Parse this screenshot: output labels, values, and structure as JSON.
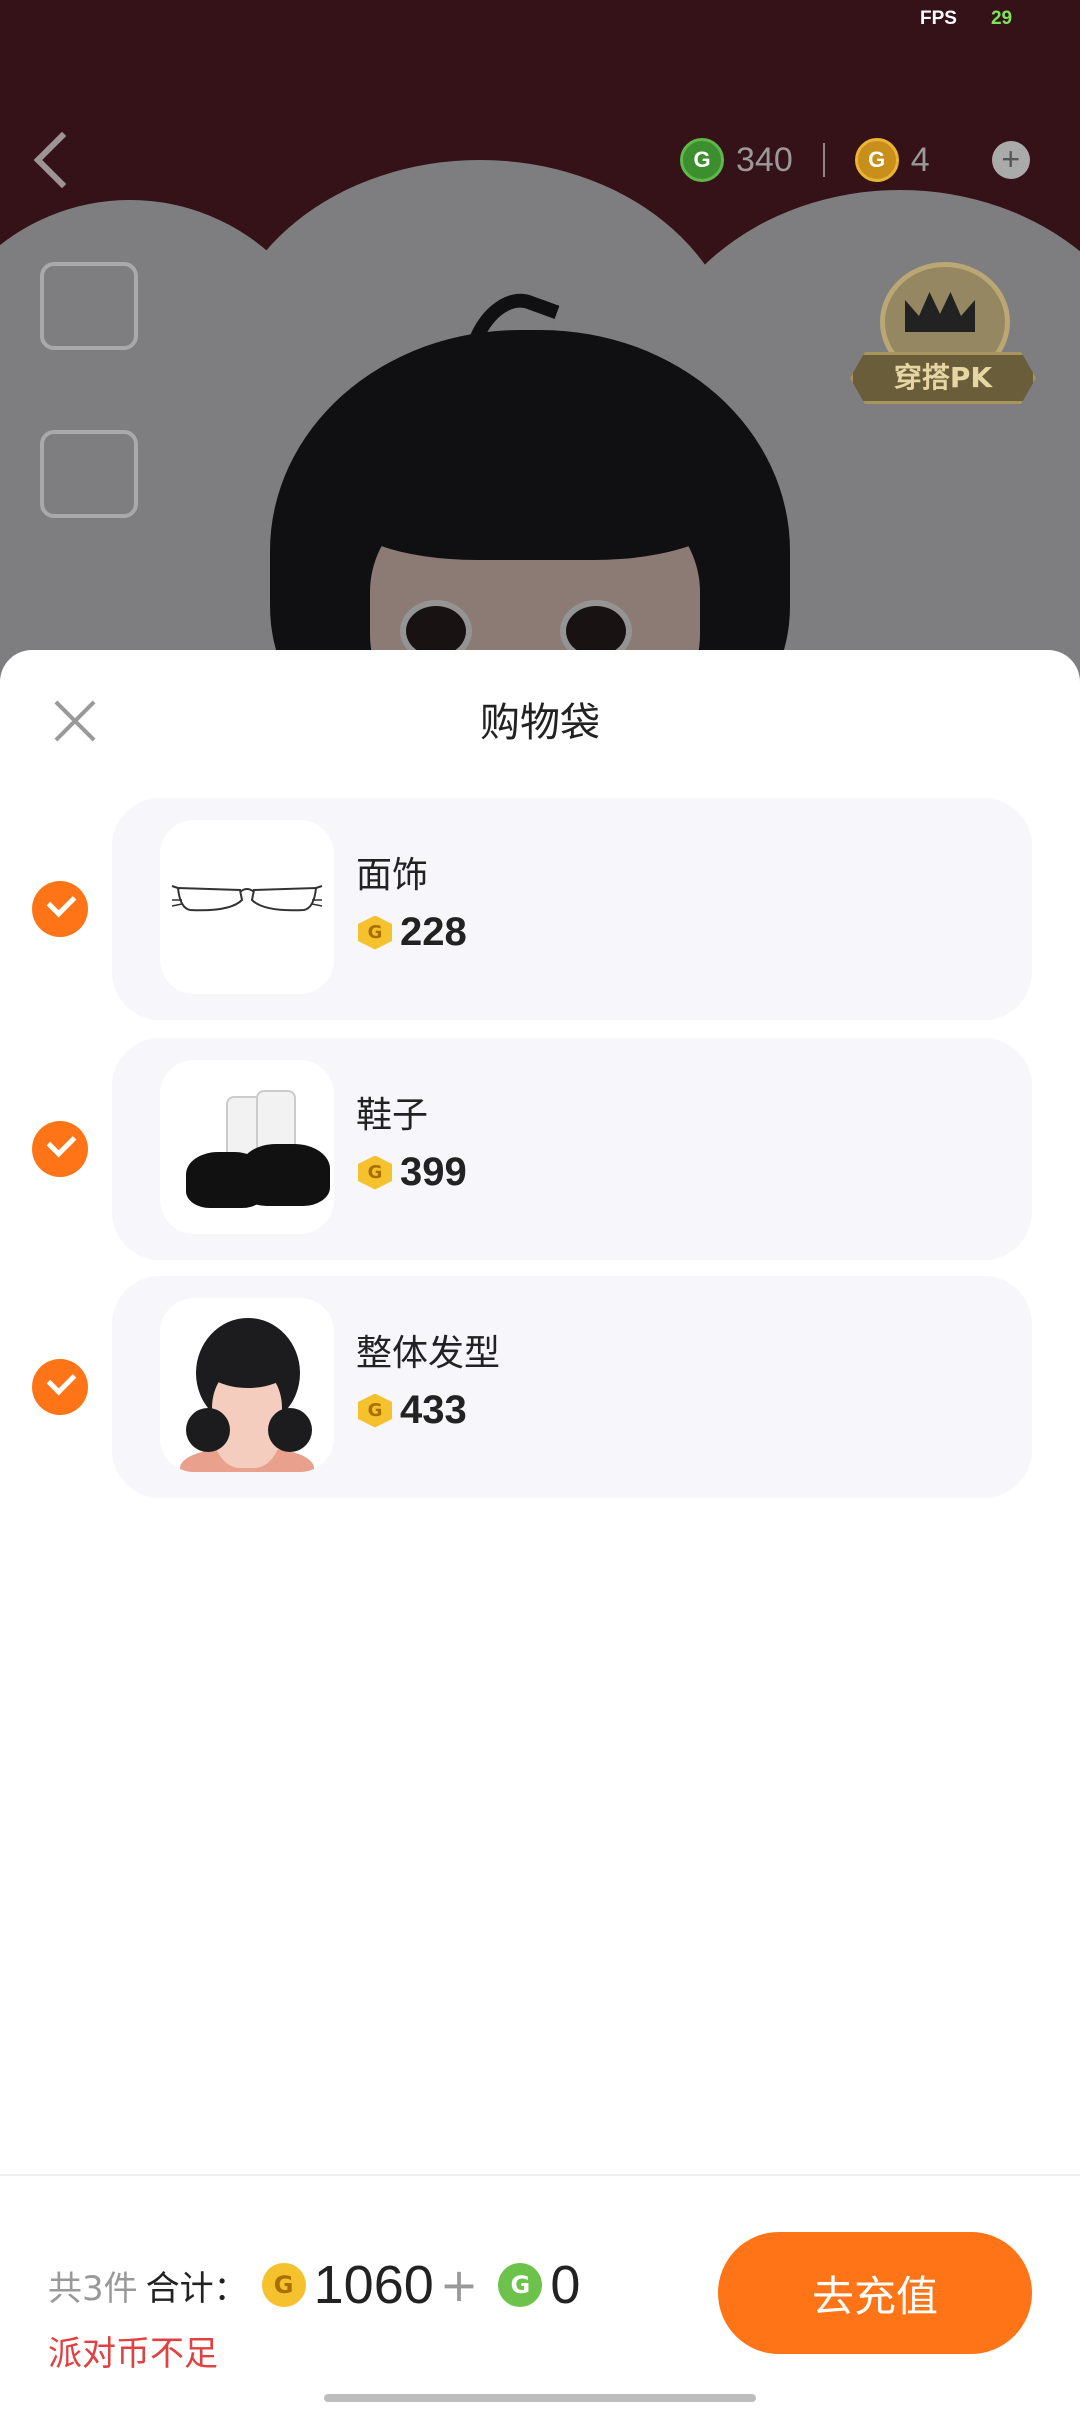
{
  "overlay": {
    "fps_label": "FPS",
    "fps_value": "29",
    "currencies": [
      {
        "icon": "green-coin-icon",
        "value": "340"
      },
      {
        "icon": "gold-coin-icon",
        "value": "4"
      }
    ],
    "pk_label": "穿搭PK"
  },
  "sheet": {
    "title": "购物袋"
  },
  "items": [
    {
      "name": "面饰",
      "price": "228",
      "checked": true
    },
    {
      "name": "鞋子",
      "price": "399",
      "checked": true
    },
    {
      "name": "整体发型",
      "price": "433",
      "checked": true
    }
  ],
  "footer": {
    "count": "共3件",
    "total_label": "合计：",
    "gold_total": "1060",
    "plus": "+",
    "green_total": "0",
    "warning": "派对币不足",
    "recharge_label": "去充值"
  },
  "colors": {
    "accent": "#ff7416",
    "warning": "#e04141",
    "gold": "#f5c12c",
    "green": "#6cc24a"
  }
}
